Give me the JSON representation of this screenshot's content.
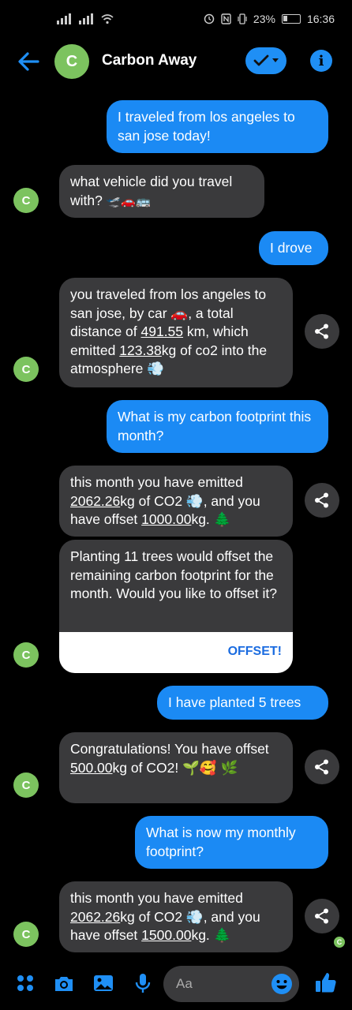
{
  "status_bar": {
    "icons_left": [
      "signal-icon",
      "signal-icon",
      "wifi-icon"
    ],
    "battery": "23%",
    "time": "16:36"
  },
  "header": {
    "avatar_letter": "C",
    "title": "Carbon Away"
  },
  "messages": [
    {
      "from": "user",
      "text": "I traveled from los angeles to san jose today!"
    },
    {
      "from": "bot",
      "text": "what vehicle did you travel with?",
      "emoji": "🛫🚗🚌"
    },
    {
      "from": "user",
      "text": "I drove"
    },
    {
      "from": "bot",
      "p1": "you traveled from los angeles to san jose, by car 🚗, a total distance of ",
      "distance": "491.55",
      "p2": " km, which emitted ",
      "emitted": "123.38",
      "p3": "kg of co2 into the atmosphere 💨"
    },
    {
      "from": "user",
      "text": "What is my carbon footprint this month?"
    },
    {
      "from": "bot",
      "p1": "this month you have emitted ",
      "emitted": "2062.26",
      "p2": "kg of CO2 💨, and you have offset ",
      "offset": "1000.00",
      "p3": "kg. 🌲"
    },
    {
      "from": "bot",
      "text": "Planting 11 trees would offset the remaining carbon footprint for the month. Would you like to offset it?",
      "button": "OFFSET!"
    },
    {
      "from": "user",
      "text": "I have planted 5 trees"
    },
    {
      "from": "bot",
      "p1": "Congratulations! You have offset ",
      "offset": "500.00",
      "p2": "kg of CO2! 🌱🥰 🌿"
    },
    {
      "from": "user",
      "text": "What is now my monthly footprint?"
    },
    {
      "from": "bot",
      "p1": "this month you have emitted ",
      "emitted": "2062.26",
      "p2": "kg of CO2 💨, and you have offset ",
      "offset": "1500.00",
      "p3": "kg. 🌲"
    }
  ],
  "composer": {
    "placeholder": "Aa"
  },
  "colors": {
    "accent": "#1b8af4",
    "avatar": "#7cc35f",
    "bubble_in": "#3a3a3c"
  }
}
